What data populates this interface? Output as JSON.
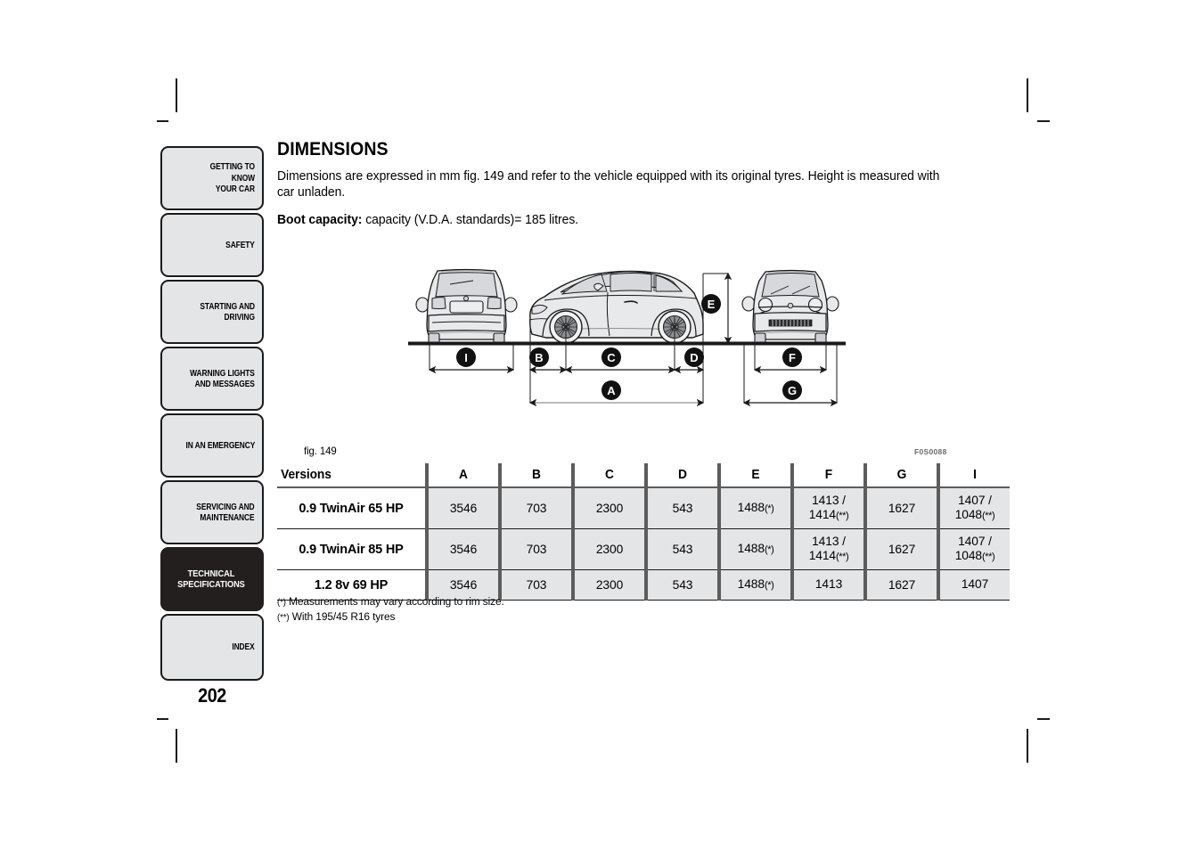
{
  "document": {
    "page_number": "202",
    "figure_code": "F0S0088",
    "figure_caption": "fig. 149"
  },
  "sidebar": {
    "items": [
      {
        "label": "GETTING TO KNOW\nYOUR CAR",
        "active": false
      },
      {
        "label": "SAFETY",
        "active": false
      },
      {
        "label": "STARTING AND\nDRIVING",
        "active": false
      },
      {
        "label": "WARNING LIGHTS\nAND MESSAGES",
        "active": false
      },
      {
        "label": "IN AN EMERGENCY",
        "active": false
      },
      {
        "label": "SERVICING AND\nMAINTENANCE",
        "active": false
      },
      {
        "label": "TECHNICAL\nSPECIFICATIONS",
        "active": true
      },
      {
        "label": "INDEX",
        "active": false
      }
    ]
  },
  "main": {
    "title": "DIMENSIONS",
    "intro": "Dimensions are expressed in mm fig. 149 and refer to the vehicle equipped with its original tyres. Height is measured with car unladen.",
    "boot_label": "Boot capacity:",
    "boot_value": " capacity (V.D.A. standards)= 185 litres."
  },
  "figure": {
    "views": [
      {
        "name": "rear-view",
        "label": "rear view of vehicle"
      },
      {
        "name": "side-view",
        "label": "side view of vehicle"
      },
      {
        "name": "front-view",
        "label": "front view of vehicle"
      }
    ],
    "markers": [
      "I",
      "B",
      "C",
      "D",
      "E",
      "A",
      "F",
      "G"
    ]
  },
  "table": {
    "headers": [
      "Versions",
      "A",
      "B",
      "C",
      "D",
      "E",
      "F",
      "G",
      "I"
    ],
    "rows": [
      {
        "version": "0.9 TwinAir 65 HP",
        "A": "3546",
        "B": "703",
        "C": "2300",
        "D": "543",
        "E": "1488",
        "E_note": "(*)",
        "F": "1413 /\n1414",
        "F_note": "(**)",
        "G": "1627",
        "I": "1407 /\n1048",
        "I_note": "(**)"
      },
      {
        "version": "0.9 TwinAir 85 HP",
        "A": "3546",
        "B": "703",
        "C": "2300",
        "D": "543",
        "E": "1488",
        "E_note": "(*)",
        "F": "1413 /\n1414",
        "F_note": "(**)",
        "G": "1627",
        "I": "1407 /\n1048",
        "I_note": "(**)"
      },
      {
        "version": "1.2 8v 69 HP",
        "A": "3546",
        "B": "703",
        "C": "2300",
        "D": "543",
        "E": "1488",
        "E_note": "(*)",
        "F": "1413",
        "F_note": "",
        "G": "1627",
        "I": "1407",
        "I_note": ""
      }
    ]
  },
  "footnotes": [
    {
      "mark": "(*)",
      "text": " Measurements may vary according to rim size."
    },
    {
      "mark": "(**)",
      "text": " With 195/45 R16 tyres"
    }
  ],
  "colors": {
    "tab_fill": "#e4e5e7",
    "tab_active": "#231f1f",
    "rule": "#5c5c5c",
    "cell_fill": "#e4e5e7",
    "car_body": "#e8e9eb",
    "car_glass": "#d6d8dc",
    "ink": "#1a1a1a"
  }
}
